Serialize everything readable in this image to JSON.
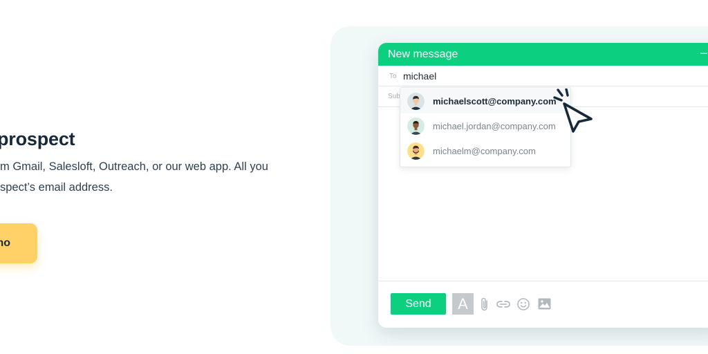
{
  "hero": {
    "heading": "prospect",
    "description_lines": [
      "m Gmail, Salesloft, Outreach, or our web app. All you",
      "spect’s email address."
    ],
    "cta_label": "no"
  },
  "compose": {
    "title": "New message",
    "close_glyph": "–",
    "to_label": "To",
    "to_value": "michael",
    "subject_label": "Sub",
    "send_label": "Send",
    "font_tool_label": "A"
  },
  "suggestions": [
    {
      "email": "michaelscott@company.com",
      "avatar_bg": "#d9e2e6",
      "skin": "#f1c6a0",
      "hair": "#2b2b2b",
      "shirt": "#22313b"
    },
    {
      "email": "michael.jordan@company.com",
      "avatar_bg": "#d4ece1",
      "skin": "#8a5a3b",
      "hair": "#2b1d15",
      "shirt": "#3a4a52"
    },
    {
      "email": "michaelm@company.com",
      "avatar_bg": "#ffe08a",
      "skin": "#e6a97b",
      "hair": "#3a2a20",
      "shirt": "#2a3b45"
    }
  ],
  "colors": {
    "brand_green": "#0ccf7f",
    "cta_yellow": "#ffd166",
    "backdrop": "#f1f8f8"
  },
  "icons": [
    "attachment-icon",
    "link-icon",
    "emoji-icon",
    "image-icon",
    "pointer-cursor-icon"
  ]
}
